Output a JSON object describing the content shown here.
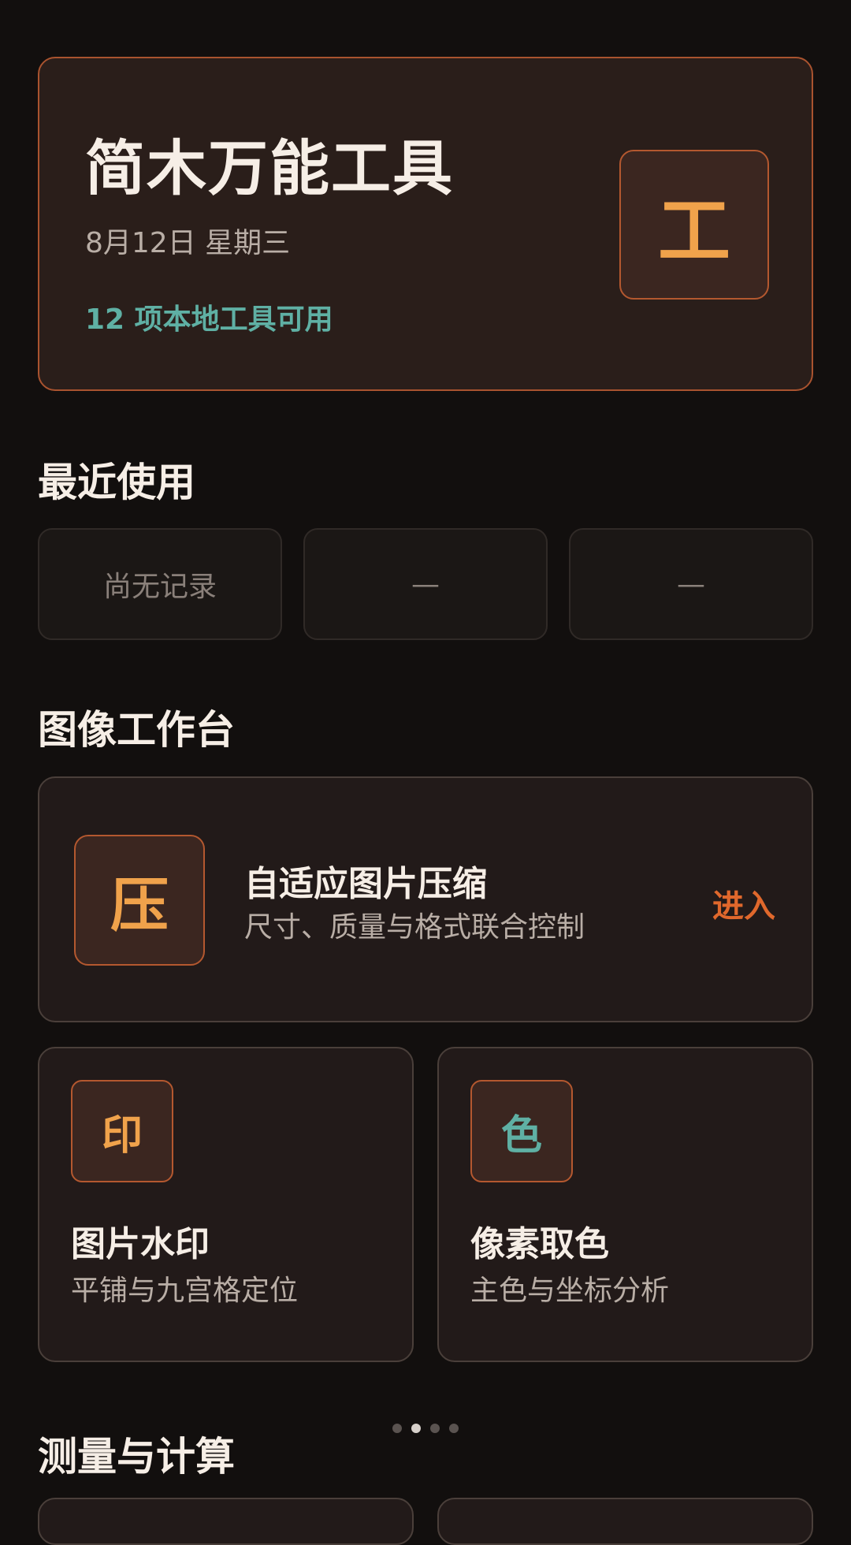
{
  "hero": {
    "title": "简木万能工具",
    "date": "8月12日 星期三",
    "tool_count": "12 项本地工具可用",
    "badge": "工"
  },
  "recent": {
    "title": "最近使用",
    "items": [
      "尚无记录",
      "—",
      "—"
    ]
  },
  "image_workbench": {
    "title": "图像工作台",
    "featured": {
      "icon": "压",
      "title": "自适应图片压缩",
      "subtitle": "尺寸、质量与格式联合控制",
      "action": "进入"
    },
    "tools": [
      {
        "icon": "印",
        "icon_color": "#f0a24b",
        "title": "图片水印",
        "subtitle": "平铺与九宫格定位"
      },
      {
        "icon": "色",
        "icon_color": "#5fb0a4",
        "title": "像素取色",
        "subtitle": "主色与坐标分析"
      }
    ]
  },
  "measure": {
    "title": "测量与计算"
  },
  "pager": {
    "count": 4,
    "active_index": 1
  },
  "colors": {
    "background": "#120f0e",
    "accent_orange": "#e0682c",
    "icon_orange": "#f0a24b",
    "teal": "#5fb0a4"
  }
}
